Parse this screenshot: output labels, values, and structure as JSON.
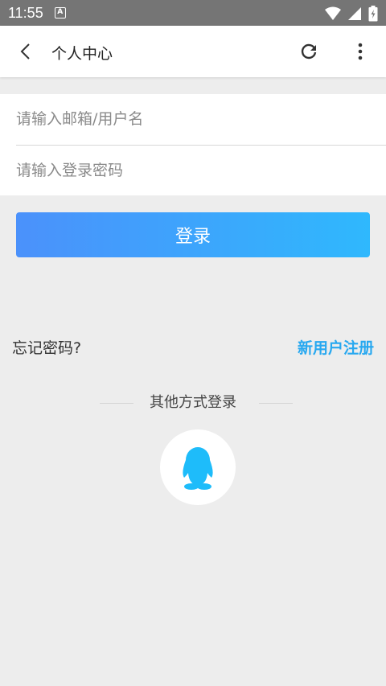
{
  "status_bar": {
    "time": "11:55",
    "notification_glyph": "A"
  },
  "app_bar": {
    "title": "个人中心"
  },
  "form": {
    "email_placeholder": "请输入邮箱/用户名",
    "password_placeholder": "请输入登录密码"
  },
  "login_button": {
    "label": "登录"
  },
  "links": {
    "forgot": "忘记密码?",
    "register": "新用户注册"
  },
  "other_login": {
    "label": "其他方式登录",
    "providers": [
      "qq"
    ]
  },
  "colors": {
    "accent": "#27a8f0",
    "button_gradient_start": "#4b91fb",
    "button_gradient_end": "#2fb8fd",
    "qq_blue": "#1ebcfa"
  },
  "icons": [
    "back-arrow-icon",
    "refresh-icon",
    "more-vert-icon",
    "qq-penguin-icon",
    "wifi-icon",
    "signal-icon",
    "battery-icon"
  ]
}
